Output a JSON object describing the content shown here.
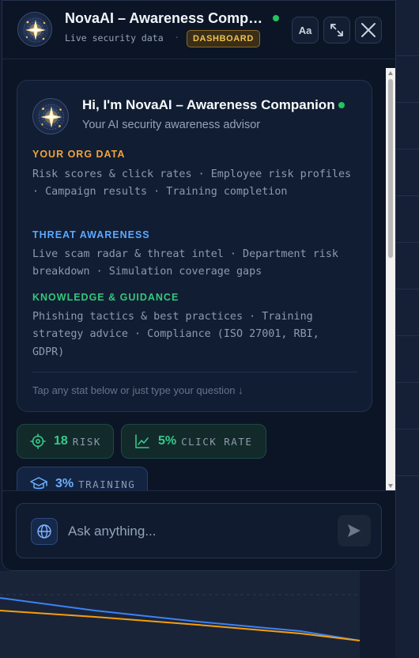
{
  "header": {
    "title": "NovaAI – Awareness Companion",
    "subtitle": "Live security data",
    "separator": "·",
    "badge": "DASHBOARD",
    "font_button": "Aa",
    "status_color": "#22c55e"
  },
  "card": {
    "title": "Hi, I'm NovaAI – Awareness Companion",
    "subtitle": "Your AI security awareness advisor",
    "sections": [
      {
        "heading": "YOUR ORG DATA",
        "body": "Risk scores & click rates · Employee risk profiles · Campaign results · Training completion",
        "color": "#f2a33a"
      },
      {
        "heading": "THREAT AWARENESS",
        "body": "Live scam radar & threat intel · Department risk breakdown · Simulation coverage gaps",
        "color": "#5aa9ff"
      },
      {
        "heading": "KNOWLEDGE & GUIDANCE",
        "body": "Phishing tactics & best practices · Training strategy advice · Compliance (ISO 27001, RBI, GDPR)",
        "color": "#34c77b"
      }
    ],
    "hint": "Tap any stat below or just type your question ↓"
  },
  "chips": {
    "risk": {
      "value": "18",
      "label": "RISK",
      "icon": "target-icon"
    },
    "click_rate": {
      "value": "5%",
      "label": "CLICK RATE",
      "icon": "line-chart-icon"
    },
    "training": {
      "value": "3%",
      "label": "TRAINING",
      "icon": "graduation-cap-icon"
    }
  },
  "input": {
    "placeholder": "Ask anything...",
    "value": ""
  }
}
